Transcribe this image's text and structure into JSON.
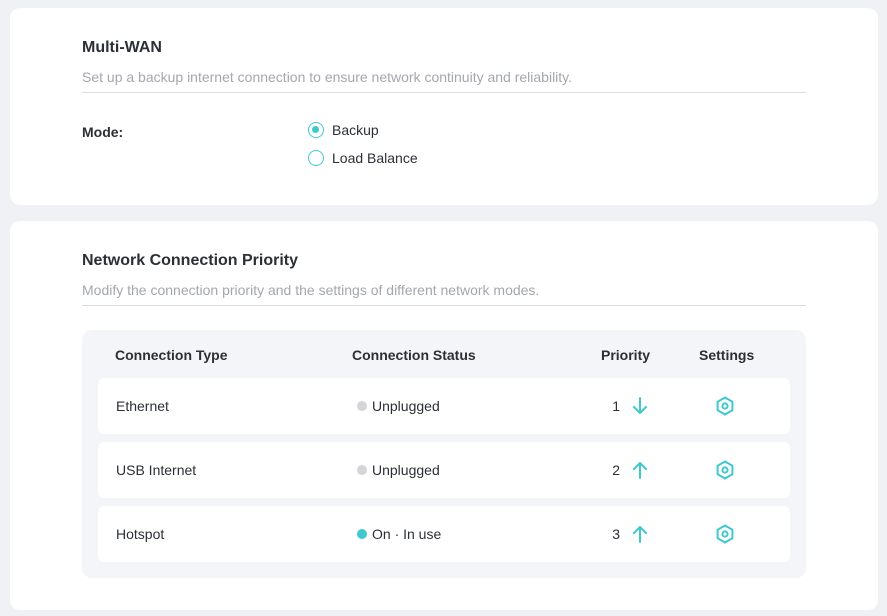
{
  "colors": {
    "accent": "#3fc8cf",
    "status_unplugged": "#d4d5d8",
    "status_on": "#3fc8cf"
  },
  "multiwan": {
    "title": "Multi-WAN",
    "description": "Set up a backup internet connection to ensure network continuity and reliability.",
    "mode_label": "Mode:",
    "options": [
      {
        "label": "Backup",
        "selected": true
      },
      {
        "label": "Load Balance",
        "selected": false
      }
    ]
  },
  "priority": {
    "title": "Network Connection Priority",
    "description": "Modify the connection priority and the settings of different network modes.",
    "columns": [
      "Connection Type",
      "Connection Status",
      "Priority",
      "Settings"
    ],
    "rows": [
      {
        "type": "Ethernet",
        "status": "Unplugged",
        "status_state": "unplugged",
        "priority": "1",
        "arrow": "arrow-down-icon"
      },
      {
        "type": "USB Internet",
        "status": "Unplugged",
        "status_state": "unplugged",
        "priority": "2",
        "arrow": "arrow-up-icon"
      },
      {
        "type": "Hotspot",
        "status": "On · In use",
        "status_state": "on",
        "priority": "3",
        "arrow": "arrow-up-icon"
      }
    ]
  }
}
